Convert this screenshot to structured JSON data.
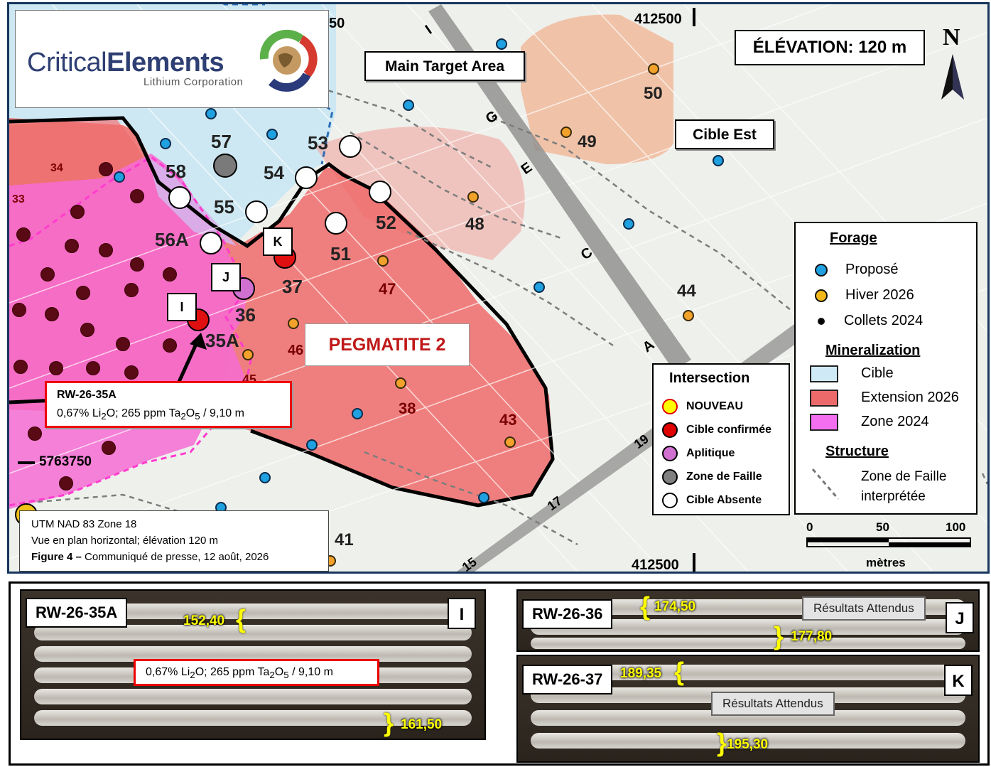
{
  "logo": {
    "name_part1": "Critical",
    "name_part2": "Elements",
    "subtitle": "Lithium Corporation"
  },
  "map": {
    "elevation_label": "ÉLÉVATION: 120 m",
    "north_label": "N",
    "main_target_label": "Main Target Area",
    "cible_est_label": "Cible Est",
    "pegmatite_label": "PEGMATITE 2",
    "fault_letters": [
      "I",
      "G",
      "E",
      "C",
      "A"
    ],
    "easting_top": "412500",
    "easting_bottom": "412500",
    "easting_fragment": "50",
    "northing_label": "5763750",
    "grid_road_labels": [
      "19",
      "17",
      "15"
    ],
    "drill_labels": [
      "57",
      "58",
      "53",
      "54",
      "55",
      "52",
      "56A",
      "51",
      "37",
      "36",
      "35A",
      "47",
      "46",
      "45",
      "38",
      "43",
      "48",
      "49",
      "50",
      "44",
      "41",
      "34",
      "33"
    ],
    "callout_letters": [
      "K",
      "J",
      "I"
    ]
  },
  "callout": {
    "hole": "RW-26-35A",
    "result_prefix": "0,67% Li",
    "sub2": "2",
    "mid": "O; 265 ppm Ta",
    "sub3": "2",
    "sub4": "O",
    "sub5": "5",
    "suffix": " / 9,10 m"
  },
  "info": {
    "line1": "UTM NAD 83 Zone 18",
    "line2": "Vue en plan horizontal; élévation 120 m",
    "fig_bold": "Figure 4 – ",
    "fig_rest": "Communiqué de presse, 12 août, 2026"
  },
  "legend_forage": {
    "title": "Forage",
    "items": [
      {
        "label": "Proposé",
        "color": "#1fa0e0"
      },
      {
        "label": "Hiver 2026",
        "color": "#f2b81a"
      },
      {
        "label": "Collets 2024",
        "color": "#000000"
      }
    ],
    "mineral_title": "Mineralization",
    "mineral_items": [
      {
        "label": "Cible",
        "color": "#cfeaf6"
      },
      {
        "label": "Extension 2026",
        "color": "#ec6a6a"
      },
      {
        "label": "Zone 2024",
        "color": "#f36ff0"
      }
    ],
    "structure_title": "Structure",
    "structure_line1": "Zone de Faille",
    "structure_line2": "interprétée"
  },
  "legend_intersection": {
    "title": "Intersection",
    "items": [
      {
        "label": "NOUVEAU",
        "fill": "#ffff00",
        "stroke": "#e00000"
      },
      {
        "label": "Cible confirmée",
        "fill": "#e00000",
        "stroke": "#000000"
      },
      {
        "label": "Aplitique",
        "fill": "#d070d0",
        "stroke": "#000000"
      },
      {
        "label": "Zone de Faille",
        "fill": "#808080",
        "stroke": "#000000"
      },
      {
        "label": "Cible Absente",
        "fill": "#ffffff",
        "stroke": "#000000"
      }
    ]
  },
  "scale": {
    "t0": "0",
    "t50": "50",
    "t100": "100",
    "unit": "mètres"
  },
  "cores": {
    "panel_i": {
      "hole": "RW-26-35A",
      "letter": "I",
      "depth_top": "152,40",
      "depth_bottom": "161,50",
      "result_prefix": "0,67% Li",
      "sub2": "2",
      "mid": "O; 265 ppm Ta",
      "sub3": "2",
      "sub4": "O",
      "sub5": "5",
      "suffix": " / 9,10 m"
    },
    "panel_j": {
      "hole": "RW-26-36",
      "letter": "J",
      "depth_top": "174,50",
      "depth_bottom": "177,80",
      "status": "Résultats Attendus"
    },
    "panel_k": {
      "hole": "RW-26-37",
      "letter": "K",
      "depth_top": "189,35",
      "depth_bottom": "195,30",
      "status": "Résultats Attendus"
    }
  }
}
